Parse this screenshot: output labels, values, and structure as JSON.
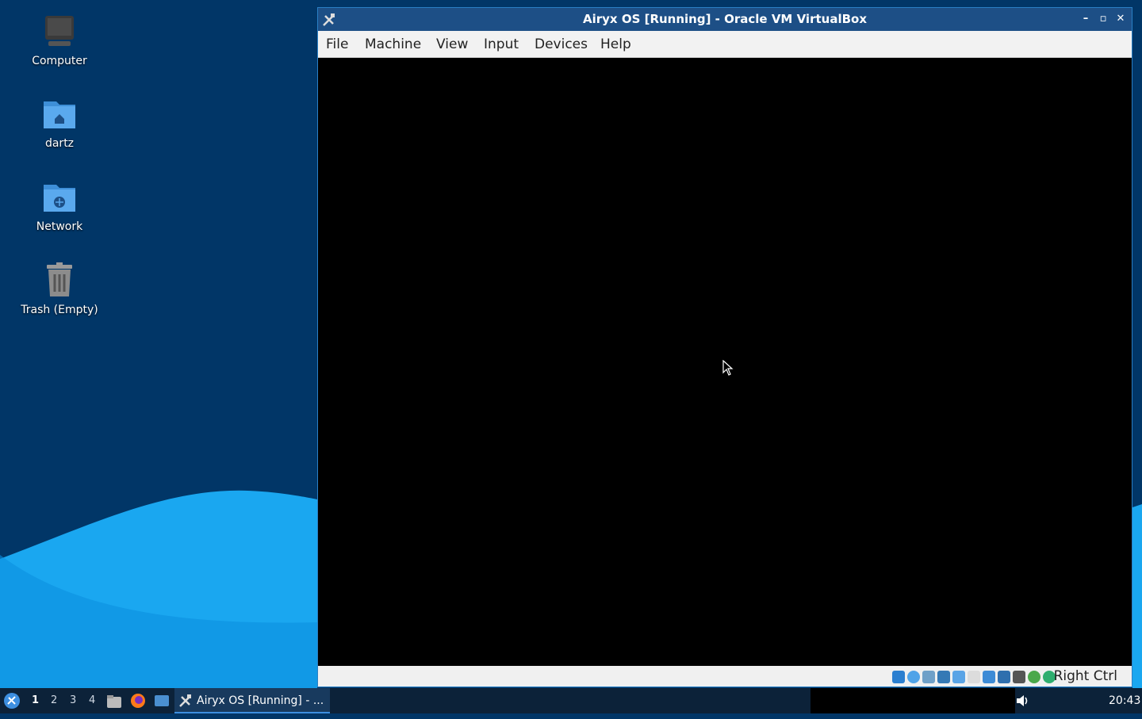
{
  "desktop": {
    "icons": [
      {
        "label": "Computer",
        "icon": "computer-icon"
      },
      {
        "label": "dartz",
        "icon": "home-folder-icon"
      },
      {
        "label": "Network",
        "icon": "network-folder-icon"
      },
      {
        "label": "Trash (Empty)",
        "icon": "trash-icon"
      }
    ]
  },
  "window": {
    "title": "Airyx OS [Running] - Oracle VM VirtualBox",
    "controls": {
      "minimize": "–",
      "maximize": "▫",
      "close": "✕"
    },
    "menu": [
      "File",
      "Machine",
      "View",
      "Input",
      "Devices",
      "Help"
    ],
    "status": {
      "host_key": "Right Ctrl",
      "icons": [
        "hard-disk-icon",
        "optical-disk-icon",
        "audio-icon",
        "network-icon",
        "usb-icon",
        "shared-folders-icon",
        "display-icon",
        "video-capture-icon",
        "virtualization-icon",
        "cpu-icon",
        "mouse-integration-icon",
        "keyboard-icon",
        "host-key-icon"
      ]
    }
  },
  "taskbar": {
    "workspaces": [
      "1",
      "2",
      "3",
      "4"
    ],
    "active_workspace": "1",
    "task_label": "Airyx OS [Running] - ...",
    "clock": "20:43"
  },
  "colors": {
    "desktop_bg": "#013667",
    "wave": "#1aa7f0",
    "titlebar": "#1d4f86",
    "taskbar": "#0c2239"
  }
}
